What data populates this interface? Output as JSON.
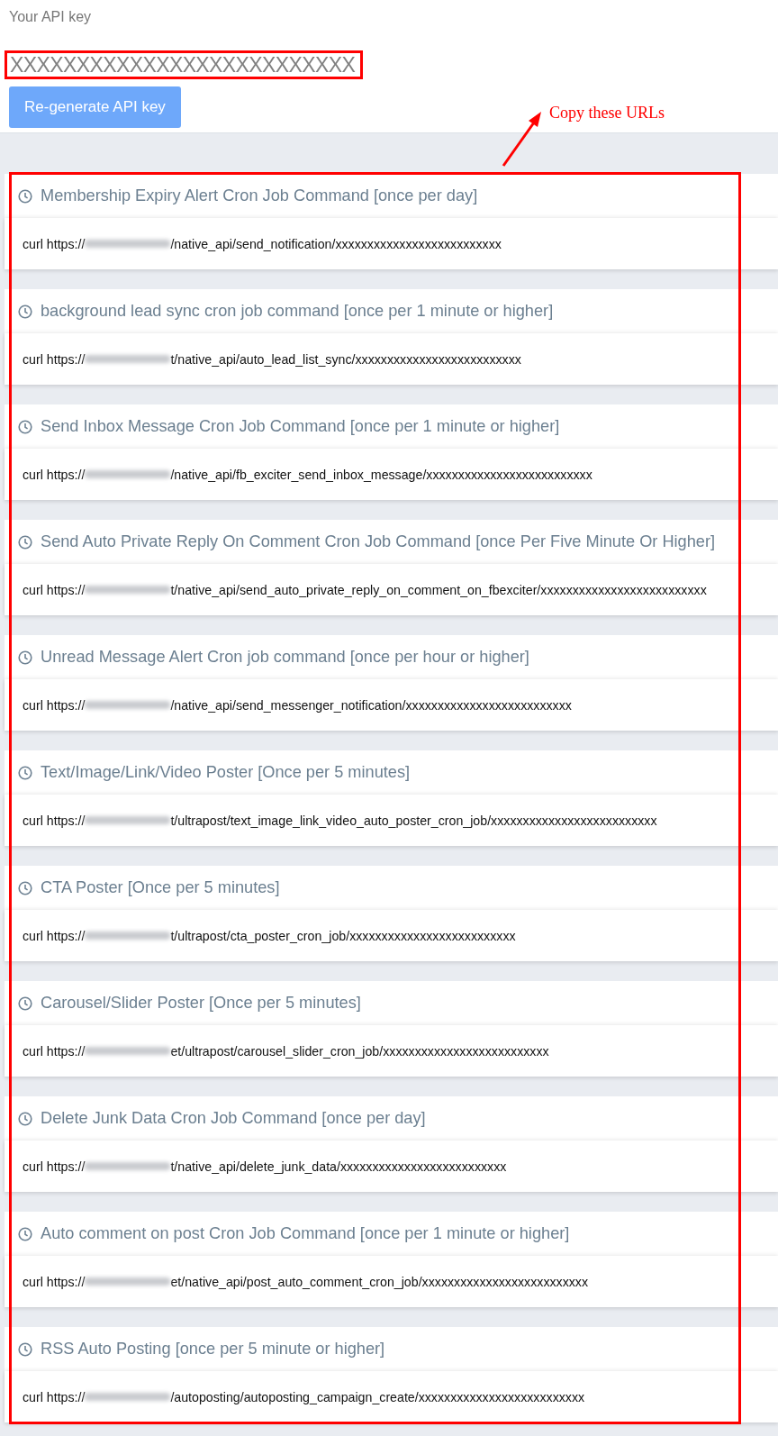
{
  "api_key": {
    "label": "Your API key",
    "value": "XXXXXXXXXXXXXXXXXXXXXXXXXX",
    "button": "Re-generate API key"
  },
  "annotation": {
    "text": "Copy these URLs"
  },
  "cron_jobs": [
    {
      "title": "Membership Expiry Alert Cron Job Command [once per day]",
      "prefix": "curl https://",
      "suffix": "/native_api/send_notification/xxxxxxxxxxxxxxxxxxxxxxxxxx"
    },
    {
      "title": "background lead sync cron job command [once per 1 minute or higher]",
      "prefix": "curl https://",
      "suffix": "t/native_api/auto_lead_list_sync/xxxxxxxxxxxxxxxxxxxxxxxxxx"
    },
    {
      "title": "Send Inbox Message Cron Job Command [once per 1 minute or higher]",
      "prefix": "curl https://",
      "suffix": "/native_api/fb_exciter_send_inbox_message/xxxxxxxxxxxxxxxxxxxxxxxxxx"
    },
    {
      "title": "Send Auto Private Reply On Comment Cron Job Command [once Per Five Minute Or Higher]",
      "prefix": "curl https://",
      "suffix": "t/native_api/send_auto_private_reply_on_comment_on_fbexciter/xxxxxxxxxxxxxxxxxxxxxxxxxx"
    },
    {
      "title": "Unread Message Alert Cron job command [once per hour or higher]",
      "prefix": "curl https://",
      "suffix": "/native_api/send_messenger_notification/xxxxxxxxxxxxxxxxxxxxxxxxxx"
    },
    {
      "title": "Text/Image/Link/Video Poster [Once per 5 minutes]",
      "prefix": "curl https://",
      "suffix": "t/ultrapost/text_image_link_video_auto_poster_cron_job/xxxxxxxxxxxxxxxxxxxxxxxxxx"
    },
    {
      "title": "CTA Poster [Once per 5 minutes]",
      "prefix": "curl https://",
      "suffix": "t/ultrapost/cta_poster_cron_job/xxxxxxxxxxxxxxxxxxxxxxxxxx"
    },
    {
      "title": "Carousel/Slider Poster [Once per 5 minutes]",
      "prefix": "curl https://",
      "suffix": "et/ultrapost/carousel_slider_cron_job/xxxxxxxxxxxxxxxxxxxxxxxxxx"
    },
    {
      "title": "Delete Junk Data Cron Job Command [once per day]",
      "prefix": "curl https://",
      "suffix": "t/native_api/delete_junk_data/xxxxxxxxxxxxxxxxxxxxxxxxxx"
    },
    {
      "title": "Auto comment on post Cron Job Command [once per 1 minute or higher]",
      "prefix": "curl https://",
      "suffix": "et/native_api/post_auto_comment_cron_job/xxxxxxxxxxxxxxxxxxxxxxxxxx"
    },
    {
      "title": "RSS Auto Posting [once per 5 minute or higher]",
      "prefix": "curl https://",
      "suffix": "/autoposting/autoposting_campaign_create/xxxxxxxxxxxxxxxxxxxxxxxxxx"
    }
  ]
}
